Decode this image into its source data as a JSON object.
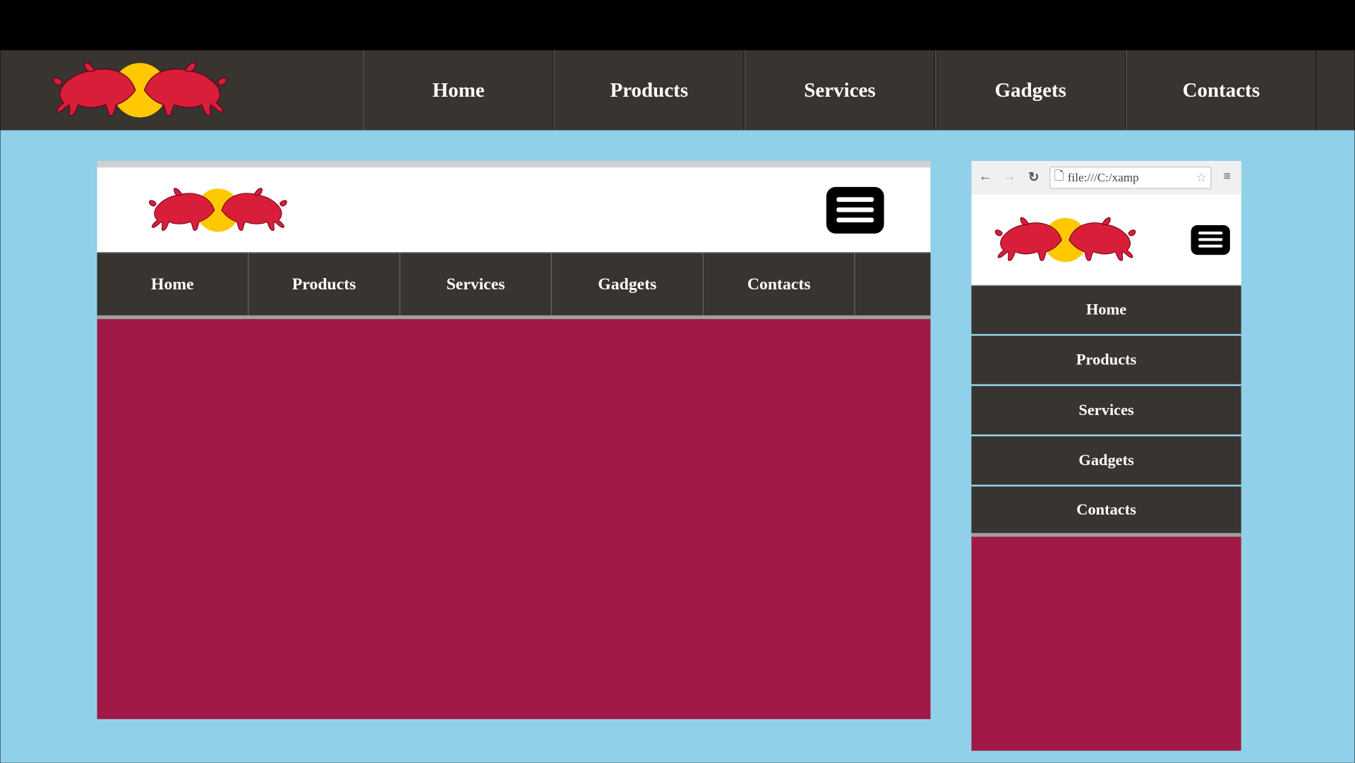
{
  "nav_items": [
    "Home",
    "Products",
    "Services",
    "Gadgets",
    "Contacts"
  ],
  "phone": {
    "url_text": "file:///C:/xamp"
  },
  "colors": {
    "nav_bg": "#38342f",
    "workspace_bg": "#90d0e8",
    "content_bg": "#a01846",
    "logo_yellow": "#ffc800",
    "logo_red": "#d91e3a"
  }
}
